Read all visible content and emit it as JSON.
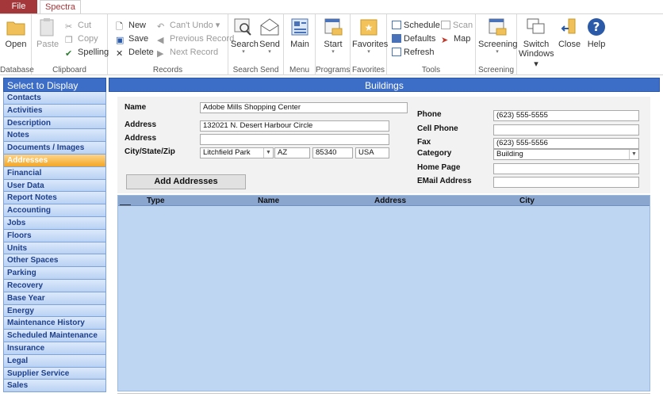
{
  "tabs": {
    "file": "File",
    "spectra": "Spectra"
  },
  "ribbon": {
    "database": {
      "label": "Database",
      "open": "Open"
    },
    "clipboard": {
      "label": "Clipboard",
      "paste": "Paste",
      "cut": "Cut",
      "copy": "Copy",
      "spelling": "Spelling"
    },
    "records": {
      "label": "Records",
      "new": "New",
      "save": "Save",
      "delete": "Delete",
      "undo": "Can't Undo",
      "previous": "Previous Record",
      "next": "Next Record"
    },
    "search_send": {
      "label": "Search Send",
      "search": "Search",
      "send": "Send"
    },
    "menu": {
      "label": "Menu",
      "main": "Main"
    },
    "programs": {
      "label": "Programs",
      "start": "Start"
    },
    "favorites": {
      "label": "Favorites",
      "favorites": "Favorites"
    },
    "tools": {
      "label": "Tools",
      "schedule": "Schedule",
      "scan": "Scan",
      "defaults": "Defaults",
      "map": "Map",
      "refresh": "Refresh"
    },
    "screening": {
      "label": "Screening",
      "screening": "Screening"
    },
    "window": {
      "switch_line1": "Switch",
      "switch_line2": "Windows",
      "close": "Close",
      "help": "Help"
    }
  },
  "nav": {
    "header": "Select to Display",
    "items": [
      "Contacts",
      "Activities",
      "Description",
      "Notes",
      "Documents / Images",
      "Addresses",
      "Financial",
      "User Data",
      "Report Notes",
      "Accounting",
      "Jobs",
      "Floors",
      "Units",
      "Other Spaces",
      "Parking",
      "Recovery",
      "Base Year",
      "Energy",
      "Maintenance History",
      "Scheduled Maintenance",
      "Insurance",
      "Legal",
      "Supplier Service",
      "Sales"
    ],
    "active_index": 5
  },
  "main": {
    "title": "Buildings",
    "form": {
      "name_label": "Name",
      "name_value": "Adobe Mills Shopping Center",
      "address_label": "Address",
      "address_value": "132021 N. Desert Harbour Circle",
      "address2_label": "Address",
      "address2_value": "",
      "csz_label": "City/State/Zip",
      "city_value": "Litchfield Park",
      "state_value": "AZ",
      "zip_value": "85340",
      "country_value": "USA",
      "phone_label": "Phone",
      "phone_value": "(623) 555-5555",
      "cell_label": "Cell Phone",
      "cell_value": "",
      "fax_label": "Fax",
      "fax_value": "(623) 555-5556",
      "category_label": "Category",
      "category_value": "Building",
      "homepage_label": "Home Page",
      "homepage_value": "",
      "email_label": "EMail Address",
      "email_value": "",
      "add_addresses": "Add Addresses"
    },
    "grid": {
      "columns": [
        "Type",
        "Name",
        "Address",
        "City"
      ]
    }
  },
  "colors": {
    "accent": "#a4373a",
    "header_blue": "#3c6ec8",
    "active_orange": "#f5a623",
    "grid_bg": "#bfd6f3"
  }
}
